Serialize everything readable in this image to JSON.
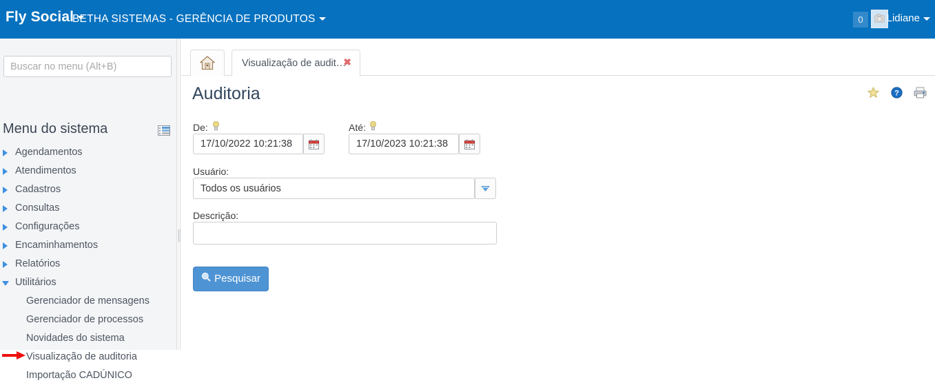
{
  "topbar": {
    "brand": "Fly Social",
    "org": "BETHA SISTEMAS - GERÊNCIA DE PRODUTOS",
    "notification_count": "0",
    "username": "Lidiane",
    "brand_caret_icon": "chevron-down-icon",
    "org_caret_icon": "chevron-down-icon",
    "avatar_icon": "avatar-photo-icon",
    "user_caret_icon": "chevron-down-icon",
    "background_color": "#0571bf"
  },
  "sidebar": {
    "search_placeholder": "Buscar no menu (Alt+B)",
    "search_value": "",
    "title": "Menu do sistema",
    "layout_icon": "menu-layout-icon",
    "items": [
      {
        "label": "Agendamentos",
        "expanded": false
      },
      {
        "label": "Atendimentos",
        "expanded": false
      },
      {
        "label": "Cadastros",
        "expanded": false
      },
      {
        "label": "Consultas",
        "expanded": false
      },
      {
        "label": "Configurações",
        "expanded": false
      },
      {
        "label": "Encaminhamentos",
        "expanded": false
      },
      {
        "label": "Relatórios",
        "expanded": false
      },
      {
        "label": "Utilitários",
        "expanded": true
      }
    ],
    "submenu": [
      {
        "label": "Gerenciador de mensagens"
      },
      {
        "label": "Gerenciador de processos"
      },
      {
        "label": "Novidades do sistema"
      },
      {
        "label": "Visualização de auditoria"
      },
      {
        "label": "Importação CADÚNICO"
      }
    ],
    "annotation": {
      "type": "red-arrow",
      "points_to": "Visualização de auditoria",
      "color": "#ee1111"
    }
  },
  "tabs": {
    "home_icon": "home-icon",
    "active_tab_label": "Visualização de audit…",
    "close_icon": "close-icon"
  },
  "page": {
    "title": "Auditoria",
    "icons": [
      {
        "name": "favorite-star-icon"
      },
      {
        "name": "help-question-icon"
      },
      {
        "name": "print-icon"
      }
    ]
  },
  "form": {
    "from": {
      "label": "De:",
      "hint_icon": "hint-bulb-icon",
      "value": "17/10/2022 10:21:38",
      "calendar_icon": "calendar-icon"
    },
    "to": {
      "label": "Até:",
      "hint_icon": "hint-bulb-icon",
      "value": "17/10/2023 10:21:38",
      "calendar_icon": "calendar-icon"
    },
    "user": {
      "label": "Usuário:",
      "value": "Todos os usuários",
      "dropdown_icon": "chevron-down-icon"
    },
    "description": {
      "label": "Descrição:",
      "value": ""
    },
    "submit": {
      "label": "Pesquisar",
      "icon": "magnifier-icon",
      "color": "#4e94d4"
    }
  }
}
